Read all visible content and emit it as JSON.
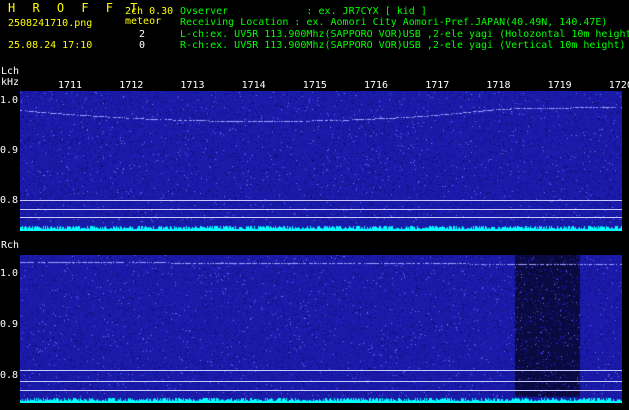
{
  "header": {
    "title": "H R O F F T",
    "filename": "2508241710.png",
    "datetime": "25.08.24 17:10",
    "config": "2ch 0.30",
    "meteor_label": "meteor",
    "count_l": "2",
    "count_r": "0",
    "observer_line": "Ovserver             : ex. JR7CYX [ kid ]",
    "location_line": "Receiving Location : ex. Aomori City Aomori-Pref.JAPAN(40.49N, 140.47E)",
    "lch_line": "L-ch:ex. UV5R 113.900Mhz(SAPPORO VOR)USB ,2-ele yagi (Holozontal 10m height)",
    "rch_line": "R-ch:ex. UV5R 113.900Mhz(SAPPORO VOR)USB ,2-ele yagi (Vertical 10m height)"
  },
  "left_axis": {
    "lch_label": "Lch",
    "unit_label": "kHz",
    "rch_label": "Rch"
  },
  "time_ticks": [
    "1711",
    "1712",
    "1713",
    "1714",
    "1715",
    "1716",
    "1717",
    "1718",
    "1719",
    "1720"
  ],
  "lch_yticks": [
    "1.0",
    "0.9",
    "0.8"
  ],
  "rch_yticks": [
    "1.0",
    "0.9",
    "0.8"
  ],
  "colors": {
    "background": "#000000",
    "spectrum": "#1a1aa8",
    "header_text": "#ffff00",
    "info_text": "#00ff00",
    "noise_floor": "#00ffff",
    "carrier": "#a0a0ff"
  }
}
